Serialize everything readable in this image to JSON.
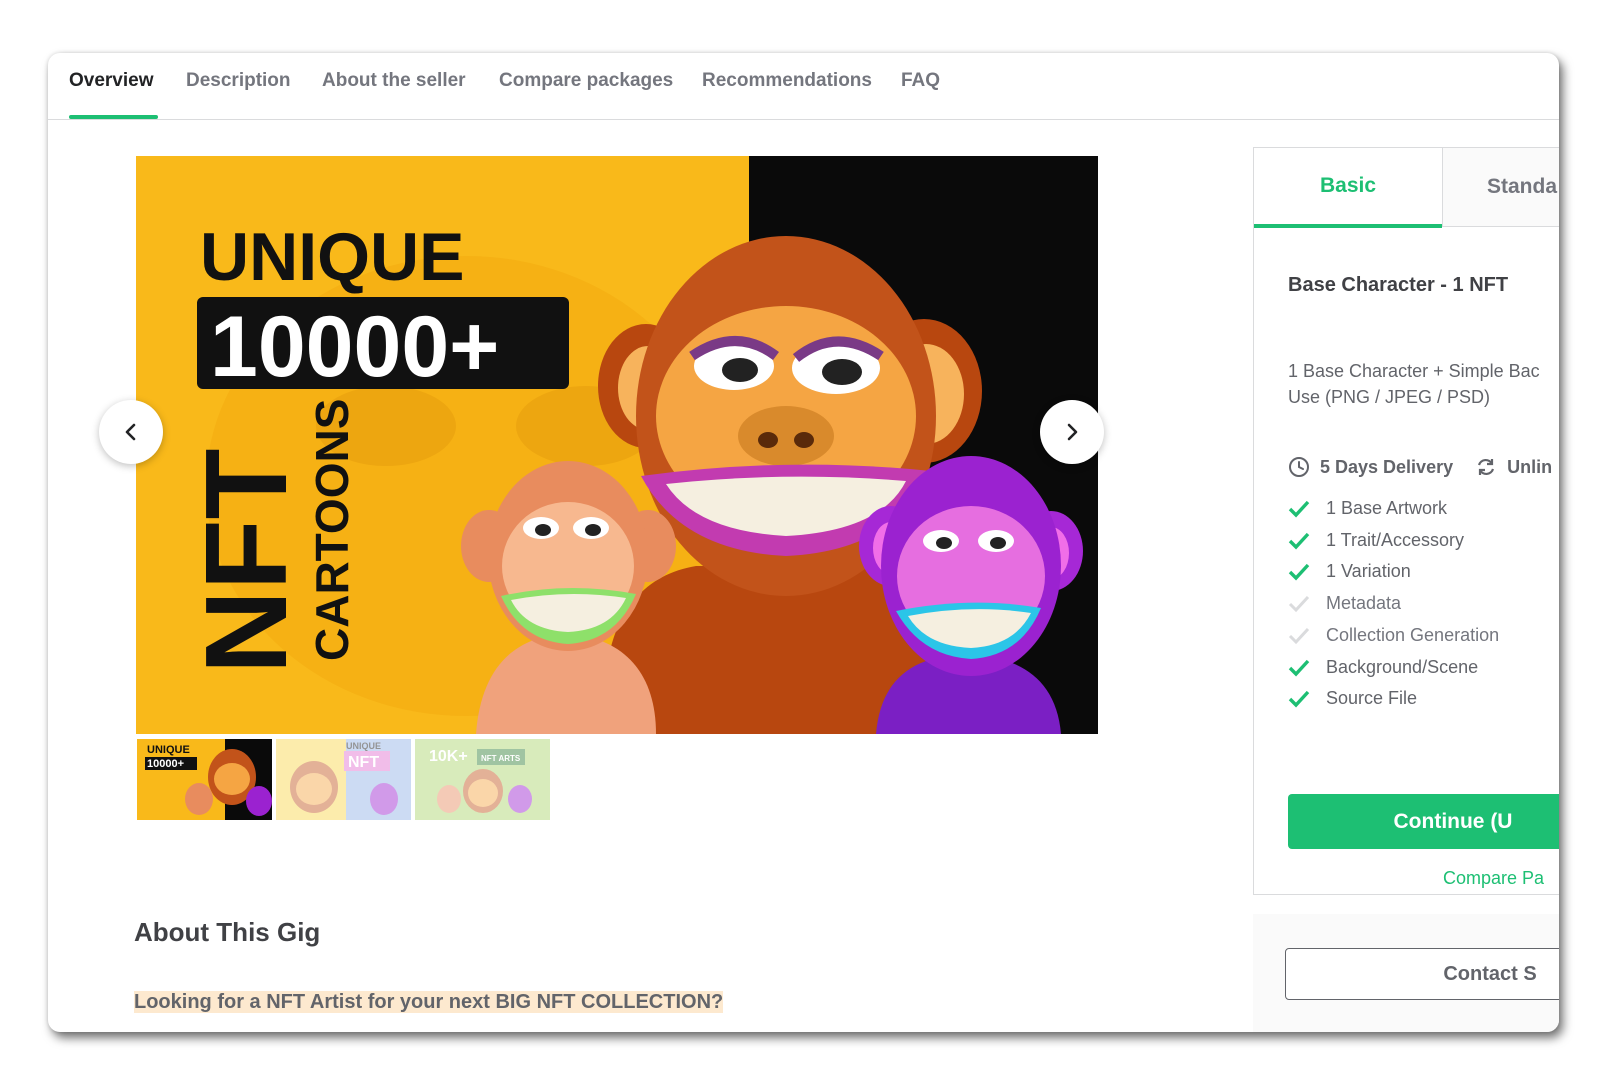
{
  "nav": {
    "tabs": [
      {
        "label": "Overview",
        "active": true
      },
      {
        "label": "Description"
      },
      {
        "label": "About the seller"
      },
      {
        "label": "Compare packages"
      },
      {
        "label": "Recommendations"
      },
      {
        "label": "FAQ"
      }
    ]
  },
  "gallery": {
    "hero": {
      "headline": "UNIQUE",
      "count": "10000+",
      "big_word": "NFT",
      "sub_word": "CARTOONS"
    },
    "thumbs": [
      {
        "caption": "UNIQUE 10000+ NFT CARTOONS"
      },
      {
        "caption": "UNIQUE NFT"
      },
      {
        "caption": "10K+ UNIQUE NFT ARTS"
      }
    ]
  },
  "about": {
    "title": "About This Gig",
    "first_line": "Looking for a NFT Artist for your next BIG NFT COLLECTION?"
  },
  "package": {
    "tabs": {
      "basic": "Basic",
      "standard": "Standa"
    },
    "title": "Base Character - 1 NFT",
    "desc_line1": "1 Base Character + Simple Bac",
    "desc_line2": "Use (PNG / JPEG / PSD)",
    "delivery": "5 Days Delivery",
    "revisions": "Unlin",
    "features": [
      {
        "label": "1 Base Artwork",
        "included": true
      },
      {
        "label": "1 Trait/Accessory",
        "included": true
      },
      {
        "label": "1 Variation",
        "included": true
      },
      {
        "label": "Metadata",
        "included": false
      },
      {
        "label": "Collection Generation",
        "included": false
      },
      {
        "label": "Background/Scene",
        "included": true
      },
      {
        "label": "Source File",
        "included": true
      }
    ],
    "continue_label": "Continue (U",
    "compare_label": "Compare Pa",
    "contact_label": "Contact S"
  },
  "colors": {
    "accent": "#1dbf73",
    "hero_yellow": "#f9b91a",
    "hero_black": "#0a0a0a"
  }
}
